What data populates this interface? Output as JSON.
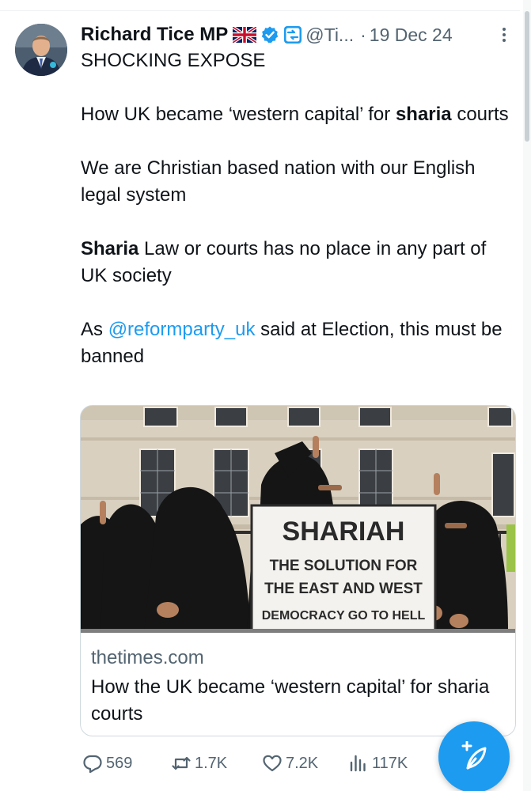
{
  "tweet": {
    "author_name": "Richard Tice MP",
    "handle": "@Ti...",
    "separator": "·",
    "date": "19 Dec 24",
    "text_line1": "SHOCKING EXPOSE",
    "text_p2_before": "How UK became ‘western capital’ for ",
    "text_p2_bold": "sharia",
    "text_p2_after": " courts",
    "text_p3": "We are Christian based nation with our English legal system",
    "text_p4_bold": "Sharia",
    "text_p4_after": " Law or courts has no place in any part of UK society",
    "text_p5_before": "As ",
    "text_p5_mention": "@reformparty_uk",
    "text_p5_after": " said at Election, this must be banned"
  },
  "card": {
    "image_sign_line1": "SHARIAH",
    "image_sign_line2": "THE SOLUTION FOR",
    "image_sign_line3": "THE EAST AND WEST",
    "image_sign_line4": "DEMOCRACY GO TO HELL",
    "domain": "thetimes.com",
    "title": "How the UK became ‘western capital’ for sharia courts"
  },
  "actions": {
    "replies": "569",
    "reposts": "1.7K",
    "likes": "7.2K",
    "views": "117K"
  },
  "icons": {
    "flag": "uk-flag-icon",
    "verified": "verified-badge-icon",
    "affiliation": "affiliation-badge-icon",
    "more": "more-vertical-icon",
    "reply": "reply-icon",
    "repost": "repost-icon",
    "like": "heart-icon",
    "views": "views-chart-icon",
    "compose": "compose-icon"
  },
  "colors": {
    "accent": "#1d9bf0",
    "text": "#0f1419",
    "muted": "#536471"
  }
}
